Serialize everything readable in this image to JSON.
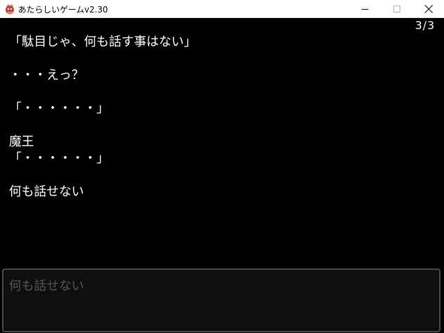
{
  "window": {
    "title": "あたらしいゲームv2.30",
    "minimize_icon": "minimize-icon",
    "maximize_icon": "maximize-icon",
    "close_icon": "close-icon",
    "app_icon": "game-app-icon"
  },
  "game": {
    "page_counter": "3/3",
    "messages": [
      "「駄目じゃ、何も話す事はない」",
      "・・・えっ？",
      "「・・・・・・」",
      "魔王",
      "「・・・・・・」",
      "何も話せない"
    ],
    "input_text": "何も話せない"
  }
}
